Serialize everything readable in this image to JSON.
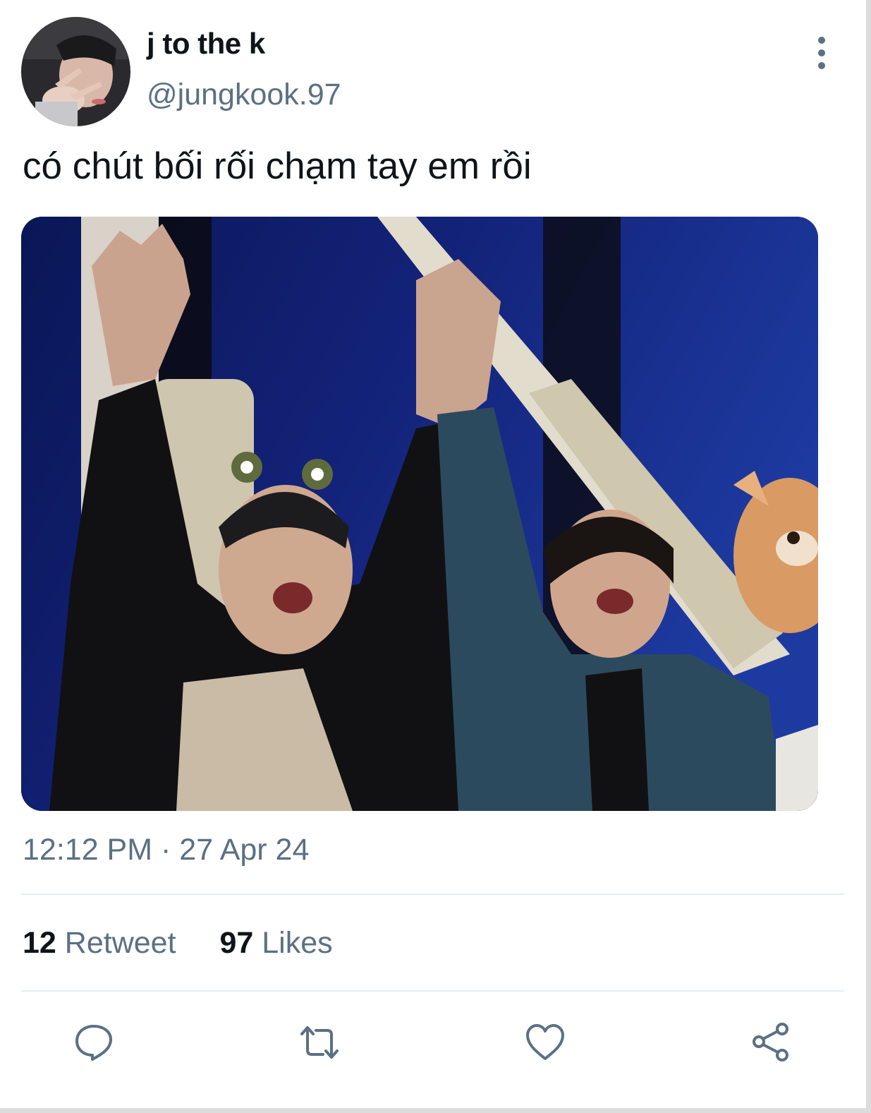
{
  "user": {
    "display_name": "j to the k",
    "handle": "@jungkook.97"
  },
  "tweet": {
    "text": "có chút bối rối chạm tay em rồi",
    "time": "12:12 PM",
    "separator": "·",
    "date": "27 Apr 24"
  },
  "stats": {
    "retweets_count": "12",
    "retweets_label": "Retweet",
    "likes_count": "97",
    "likes_label": "Likes"
  },
  "icons": {
    "more": "more-vertical-icon",
    "reply": "reply-icon",
    "retweet": "retweet-icon",
    "like": "heart-icon",
    "share": "share-icon"
  },
  "colors": {
    "text_primary": "#0f1419",
    "text_secondary": "#5b7083",
    "divider": "#e6ecf0",
    "photo_background": "#0c1550"
  }
}
